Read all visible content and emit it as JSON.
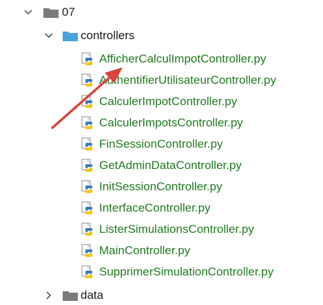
{
  "tree": {
    "root": {
      "label": "07",
      "expanded": true
    },
    "folder": {
      "label": "controllers",
      "expanded": true
    },
    "files": [
      "AfficherCalculImpotController.py",
      "AuthentifierUtilisateurController.py",
      "CalculerImpotController.py",
      "CalculerImpotsController.py",
      "FinSessionController.py",
      "GetAdminDataController.py",
      "InitSessionController.py",
      "InterfaceController.py",
      "ListerSimulationsController.py",
      "MainController.py",
      "SupprimerSimulationController.py"
    ],
    "sibling": {
      "label": "data",
      "expanded": false
    }
  },
  "colors": {
    "file_text": "#1f7a1f",
    "folder_gray": "#7a7a7a",
    "folder_blue": "#4aa3df",
    "arrow": "#d9453a"
  }
}
